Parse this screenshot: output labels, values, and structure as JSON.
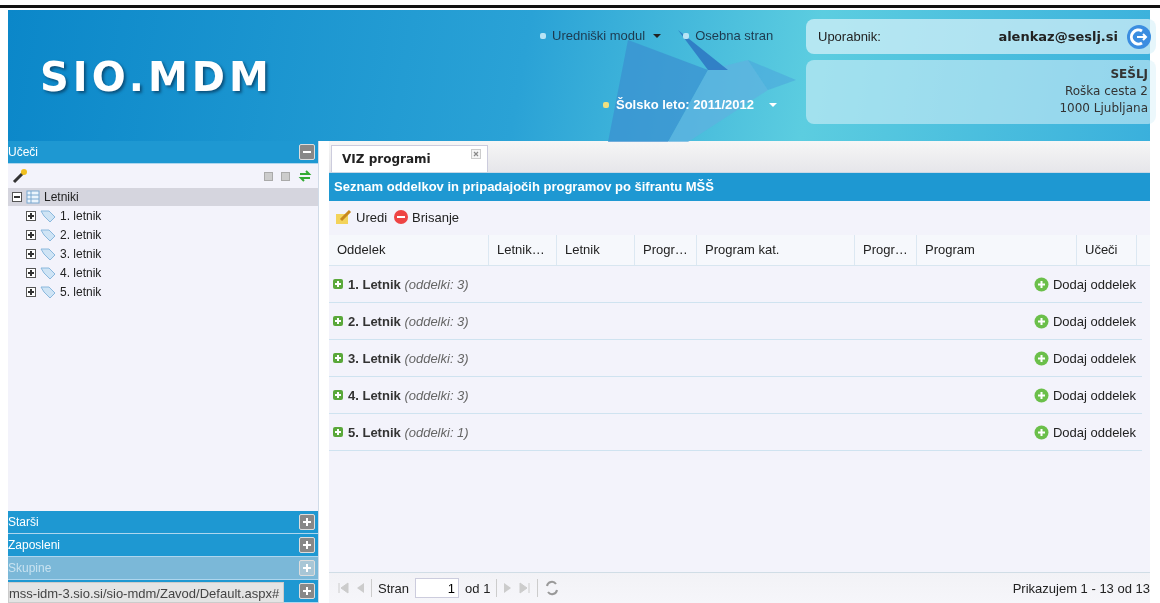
{
  "header": {
    "logo": "SIO.MDM",
    "nav": [
      {
        "label": "Uredniški modul",
        "dropdown": true
      },
      {
        "label": "Osebna stran",
        "dropdown": false
      }
    ],
    "school_year": "Šolsko leto: 2011/2012",
    "user_label": "Uporabnik:",
    "user": "alenkaz@seslj.si",
    "school": {
      "name": "SEŠLJ",
      "street": "Roška cesta 2",
      "city": "1000 Ljubljana"
    }
  },
  "sidebar": {
    "panels": [
      {
        "title": "Učeči",
        "expanded": true,
        "disabled": false
      },
      {
        "title": "Starši",
        "expanded": false,
        "disabled": false
      },
      {
        "title": "Zaposleni",
        "expanded": false,
        "disabled": false
      },
      {
        "title": "Skupine",
        "expanded": false,
        "disabled": true
      },
      {
        "expanded": false,
        "disabled": false
      }
    ],
    "tree": {
      "label": "Letniki",
      "expanded": true,
      "selected": true,
      "children": [
        {
          "label": "1. letnik",
          "expanded": false
        },
        {
          "label": "2. letnik",
          "expanded": false
        },
        {
          "label": "3. letnik",
          "expanded": false
        },
        {
          "label": "4. letnik",
          "expanded": false
        },
        {
          "label": "5. letnik",
          "expanded": false
        }
      ]
    }
  },
  "tabs": [
    {
      "label": "VIZ programi",
      "selected": true
    }
  ],
  "grid": {
    "title": "Seznam oddelkov in pripadajočih programov po šifrantu MŠŠ",
    "toolbar": [
      {
        "kind": "edit",
        "label": "Uredi"
      },
      {
        "kind": "delete",
        "label": "Brisanje"
      }
    ],
    "columns": [
      "Oddelek",
      "Letnik…",
      "Letnik",
      "Progr…",
      "Program kat.",
      "Progr…",
      "Program",
      "Učeči"
    ],
    "groups": [
      {
        "title": "1. Letnik",
        "count": "(oddelki: 3)",
        "action": "Dodaj oddelek"
      },
      {
        "title": "2. Letnik",
        "count": "(oddelki: 3)",
        "action": "Dodaj oddelek"
      },
      {
        "title": "3. Letnik",
        "count": "(oddelki: 3)",
        "action": "Dodaj oddelek"
      },
      {
        "title": "4. Letnik",
        "count": "(oddelki: 3)",
        "action": "Dodaj oddelek"
      },
      {
        "title": "5. Letnik",
        "count": "(oddelki: 1)",
        "action": "Dodaj oddelek"
      }
    ],
    "pager": {
      "page_label": "Stran",
      "page": "1",
      "of": "od 1",
      "summary": "Prikazujem 1 - 13 od 13"
    }
  },
  "status_url": "mss-idm-3.sio.si/sio-mdm/Zavod/Default.aspx#"
}
